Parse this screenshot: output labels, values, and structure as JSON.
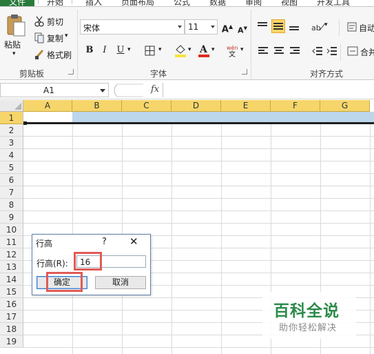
{
  "tabs": [
    "文件",
    "开始",
    "插入",
    "页面布局",
    "公式",
    "数据",
    "审阅",
    "视图",
    "开发工具"
  ],
  "clipboard": {
    "paste_label": "粘贴",
    "cut_label": "剪切",
    "copy_label": "复制",
    "format_painter_label": "格式刷",
    "group_label": "剪贴板"
  },
  "font": {
    "name": "宋体",
    "size": "11",
    "bold": "B",
    "italic": "I",
    "underline": "U",
    "group_label": "字体",
    "font_color": "#e02b20",
    "highlight_color": "#f7e43c"
  },
  "alignment": {
    "wrap_label": "自动换行",
    "merge_label": "合并",
    "group_label": "对齐方式"
  },
  "formula_bar": {
    "name_box": "A1",
    "fx": "fx"
  },
  "sheet": {
    "columns": [
      "A",
      "B",
      "C",
      "D",
      "E",
      "F",
      "G"
    ],
    "rows": [
      "1",
      "2",
      "3",
      "4",
      "5",
      "6",
      "7",
      "8",
      "9",
      "10",
      "11",
      "12",
      "13",
      "14",
      "15",
      "16",
      "17",
      "18",
      "19"
    ]
  },
  "dialog": {
    "title": "行高",
    "help": "?",
    "close": "✕",
    "row_height_label": "行高(R):",
    "row_height_value": "16",
    "ok_label": "确定",
    "cancel_label": "取消"
  },
  "watermark": {
    "title": "百科全说",
    "subtitle": "助你轻松解决"
  },
  "colors": {
    "accent": "#2a7a3b",
    "header_selected": "#f6d56a",
    "selection": "#bcd6ec",
    "highlight_box": "#e15a55",
    "watermark_green": "#2c8a4a"
  }
}
